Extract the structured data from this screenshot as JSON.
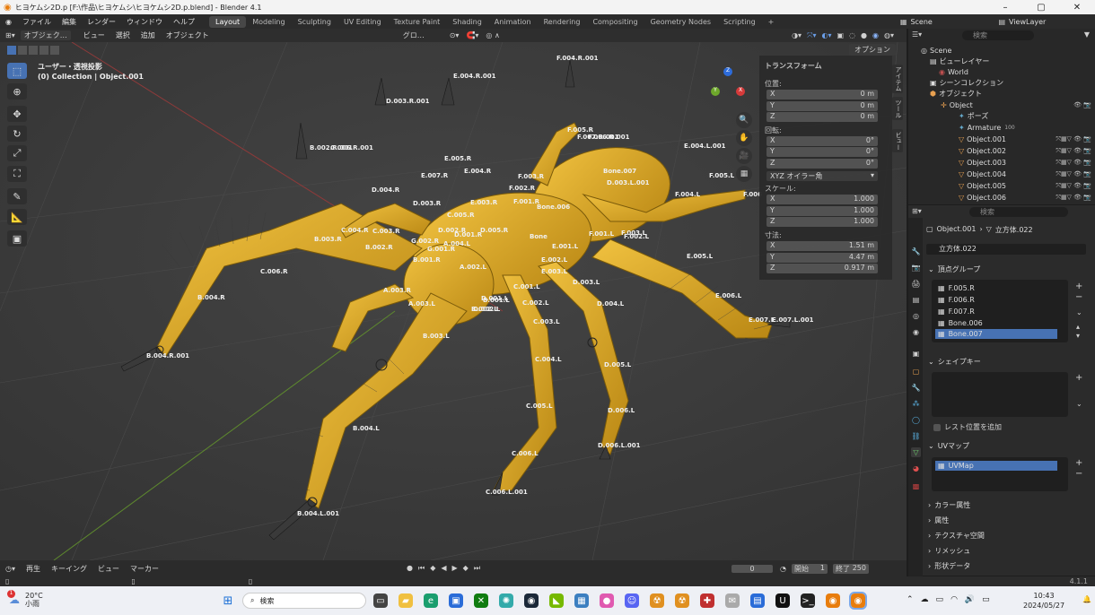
{
  "window": {
    "title": "ヒヨケムシ2D.p [F:\\作品\\ヒヨケムシ\\ヒヨケムシ2D.p.blend] - Blender 4.1"
  },
  "menu": {
    "items": [
      "ファイル",
      "編集",
      "レンダー",
      "ウィンドウ",
      "ヘルプ"
    ],
    "workspaces": [
      "Layout",
      "Modeling",
      "Sculpting",
      "UV Editing",
      "Texture Paint",
      "Shading",
      "Animation",
      "Rendering",
      "Compositing",
      "Geometry Nodes",
      "Scripting"
    ],
    "add_tab": "+",
    "scene": "Scene",
    "view_layer": "ViewLayer"
  },
  "viewport_header": {
    "mode": "オブジェク…",
    "view": "ビュー",
    "select": "選択",
    "add": "追加",
    "object": "オブジェクト",
    "transform_orient": "グロ…",
    "options": "オプション"
  },
  "viewport": {
    "view_name": "ユーザー・透視投影",
    "collection_info": "(0) Collection | Object.001",
    "gizmo": {
      "y": "Y",
      "x_neg": "X",
      "z": "Z"
    },
    "bone_labels": [
      "F.004.R.001",
      "E.004.R.001",
      "D.003.R.001",
      "B.002.R.001",
      "C.006.R.001",
      "E.005.R",
      "F.005.R",
      "F.006.R.001",
      "F.007.R.001",
      "E.004.L.001",
      "F.005.L",
      "F.006",
      "Bone.007",
      "D.003.L.001",
      "D.004.R",
      "D.003.R",
      "E.007.R",
      "E.003.R",
      "E.004.R",
      "F.003.R",
      "F.002.R",
      "F.001.R",
      "C.005.R",
      "C.004.R",
      "C.003.R",
      "B.003.R",
      "B.002.R",
      "B.001.R",
      "G.002.R",
      "G.001.R",
      "D.002.R",
      "Bone.006",
      "Bone",
      "D.001.R",
      "D.005.R",
      "C.006.R",
      "B.004.R",
      "B.004.R.001",
      "F.004.L",
      "F.003.L",
      "F.002.L",
      "F.001.L",
      "E.001.L",
      "E.002.L",
      "E.003.L",
      "D.001.L",
      "C.001.L",
      "C.002.L",
      "C.003.L",
      "B.001.L",
      "A.003.R",
      "A.003.L",
      "D.002.L",
      "D.003.L",
      "D.004.L",
      "D.005.L",
      "D.006.L",
      "D.006.L.001",
      "C.004.L",
      "C.005.L",
      "C.006.L",
      "C.006.L.001",
      "B.003.L",
      "B.004.L",
      "B.004.L.001",
      "E.006.L",
      "E.005.L",
      "E.007.L",
      "E.007.L.001",
      "A.002.L",
      "A.004.L",
      "B.002.L"
    ]
  },
  "npanel": {
    "transform": "トランスフォーム",
    "location": "位置:",
    "rotation": "回転:",
    "mode": "XYZ オイラー角",
    "scale": "スケール:",
    "dimensions": "寸法:",
    "loc": [
      {
        "axis": "X",
        "value": "0 m"
      },
      {
        "axis": "Y",
        "value": "0 m"
      },
      {
        "axis": "Z",
        "value": "0 m"
      }
    ],
    "rot": [
      {
        "axis": "X",
        "value": "0°"
      },
      {
        "axis": "Y",
        "value": "0°"
      },
      {
        "axis": "Z",
        "value": "0°"
      }
    ],
    "scl": [
      {
        "axis": "X",
        "value": "1.000"
      },
      {
        "axis": "Y",
        "value": "1.000"
      },
      {
        "axis": "Z",
        "value": "1.000"
      }
    ],
    "dim": [
      {
        "axis": "X",
        "value": "1.51 m"
      },
      {
        "axis": "Y",
        "value": "4.47 m"
      },
      {
        "axis": "Z",
        "value": "0.917 m"
      }
    ],
    "tabs": [
      "アイテム",
      "ツール",
      "ビュー"
    ]
  },
  "outliner": {
    "search_placeholder": "検索",
    "rows": [
      "Scene",
      "ビューレイヤー",
      "World",
      "シーンコレクション",
      "オブジェクト",
      "Object",
      "ポーズ",
      "Armature",
      "Object.001",
      "Object.002",
      "Object.003",
      "Object.004",
      "Object.005",
      "Object.006"
    ],
    "armature_count": "100"
  },
  "properties": {
    "search_placeholder": "検索",
    "object": "Object.001",
    "mesh": "立方体.022",
    "mesh_name": "立方体.022",
    "vertex_groups": "頂点グループ",
    "groups": [
      "F.005.R",
      "F.006.R",
      "F.007.R",
      "Bone.006",
      "Bone.007"
    ],
    "shape_keys": "シェイプキー",
    "rest_pos": "レスト位置を追加",
    "uv_maps": "UVマップ",
    "uvmap": "UVMap",
    "sections": [
      "カラー属性",
      "属性",
      "テクスチャ空間",
      "リメッシュ",
      "形状データ"
    ]
  },
  "timeline": {
    "playback": "再生",
    "keying": "キーイング",
    "view": "ビュー",
    "marker": "マーカー",
    "current": "0",
    "start_label": "開始",
    "start": "1",
    "end_label": "終了",
    "end": "250"
  },
  "status": {
    "version": "4.1.1"
  },
  "taskbar": {
    "temp": "20°C",
    "weather": "小雨",
    "badge": "1",
    "search": "検索",
    "time": "10:43",
    "date": "2024/05/27"
  }
}
